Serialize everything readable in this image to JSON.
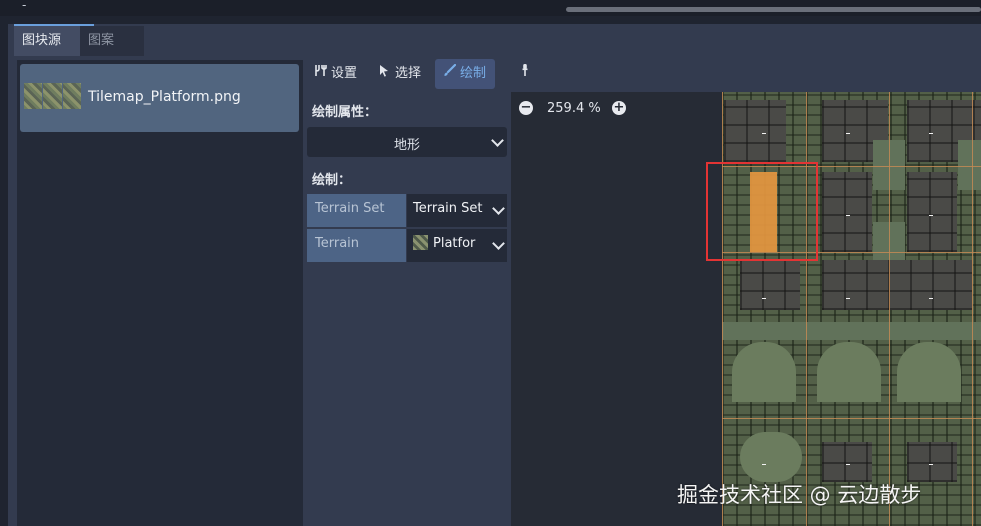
{
  "topbar": {
    "dash": "-"
  },
  "tabs": [
    {
      "label": "图块源",
      "active": true
    },
    {
      "label": "图案",
      "active": false
    }
  ],
  "sources": [
    {
      "label": "Tilemap_Platform.png",
      "selected": true
    }
  ],
  "toolbar": {
    "settings_label": "设置",
    "select_label": "选择",
    "paint_label": "绘制",
    "settings_icon": "tools-icon",
    "select_icon": "cursor-icon",
    "paint_icon": "brush-icon",
    "picker_icon": "eyedropper-icon"
  },
  "paint_properties": {
    "heading": "绘制属性：",
    "selected": "地形"
  },
  "paint_section": {
    "heading": "绘制：",
    "rows": [
      {
        "key": "Terrain Set",
        "value": "Terrain Set"
      },
      {
        "key": "Terrain",
        "value": "Platfor"
      }
    ]
  },
  "zoom": {
    "value": "259.4 %",
    "minus": "−",
    "plus": "+"
  },
  "colors": {
    "accent": "#79aee8",
    "selection_highlight": "#e59740",
    "annotation_box": "#e33434"
  },
  "watermark": "掘金技术社区 @ 云边散步"
}
